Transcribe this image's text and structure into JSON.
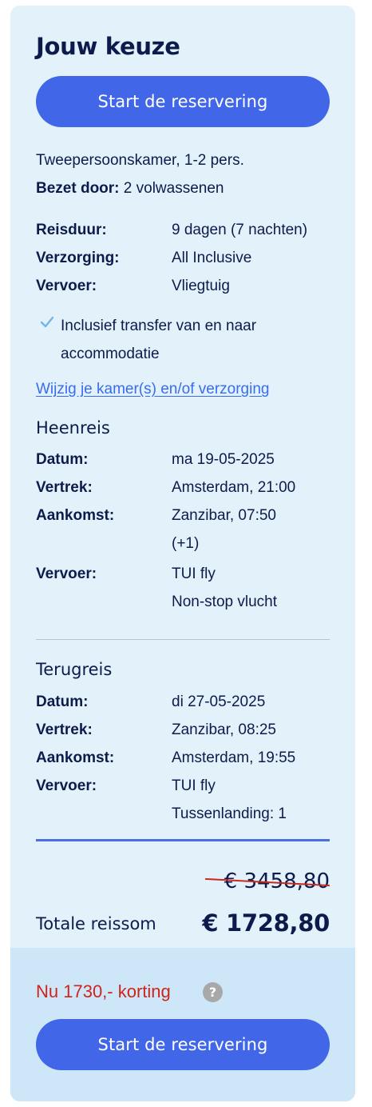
{
  "title": "Jouw keuze",
  "cta_label": "Start de reservering",
  "room": {
    "type": "Tweepersoonskamer, 1-2 pers.",
    "occupied_label": "Bezet door:",
    "occupied_value": "2 volwassenen"
  },
  "details": [
    {
      "label": "Reisduur:",
      "value": "9 dagen (7 nachten)"
    },
    {
      "label": "Verzorging:",
      "value": "All Inclusive"
    },
    {
      "label": "Vervoer:",
      "value": "Vliegtuig"
    }
  ],
  "transfer": {
    "line1": "Inclusief transfer van en naar",
    "line2": "accommodatie",
    "icon": "check-icon"
  },
  "change_link": "Wijzig je kamer(s) en/of verzorging",
  "outbound": {
    "heading": "Heenreis",
    "rows": [
      {
        "label": "Datum:",
        "value": "ma 19-05-2025"
      },
      {
        "label": "Vertrek:",
        "value": "Amsterdam, 21:00"
      },
      {
        "label": "Aankomst:",
        "value": "Zanzibar, 07:50",
        "extra": "(+1)"
      },
      {
        "label": "Vervoer:",
        "value": "TUI fly",
        "extra": "Non-stop vlucht"
      }
    ]
  },
  "return": {
    "heading": "Terugreis",
    "rows": [
      {
        "label": "Datum:",
        "value": "di 27-05-2025"
      },
      {
        "label": "Vertrek:",
        "value": "Zanzibar, 08:25"
      },
      {
        "label": "Aankomst:",
        "value": "Amsterdam, 19:55"
      },
      {
        "label": "Vervoer:",
        "value": "TUI fly",
        "extra": "Tussenlanding: 1"
      }
    ]
  },
  "price": {
    "old": "€ 3458,80",
    "total_label": "Totale reissom",
    "total": "€ 1728,80"
  },
  "discount": {
    "text": "Nu 1730,- korting",
    "help": "?"
  },
  "colors": {
    "card_bg": "#e3f2fa",
    "bottom_bg": "#cde7f8",
    "button": "#4167e8",
    "text": "#0d1b4c",
    "link": "#3a6cf0",
    "discount": "#d0241a"
  }
}
